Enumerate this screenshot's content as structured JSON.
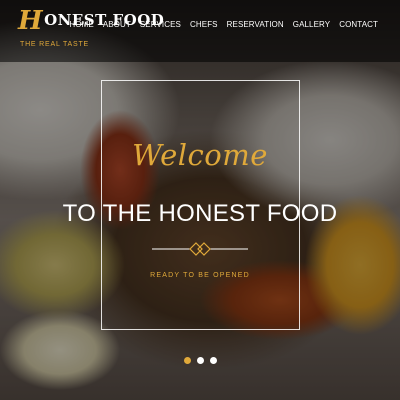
{
  "brand": {
    "initial": "H",
    "name_rest": "ONEST FOOD",
    "tagline": "THE REAL TASTE"
  },
  "nav": {
    "items": [
      "HOME",
      "ABOUT",
      "SERVICES",
      "CHEFS",
      "RESERVATION",
      "GALLERY",
      "CONTACT"
    ]
  },
  "hero": {
    "welcome": "Welcome",
    "headline": "TO THE HONEST FOOD",
    "subtitle": "READY TO BE OPENED",
    "slides": 3,
    "active_slide": 1
  },
  "colors": {
    "accent": "#e0a93a",
    "text": "#ffffff",
    "topbar": "#000000"
  }
}
